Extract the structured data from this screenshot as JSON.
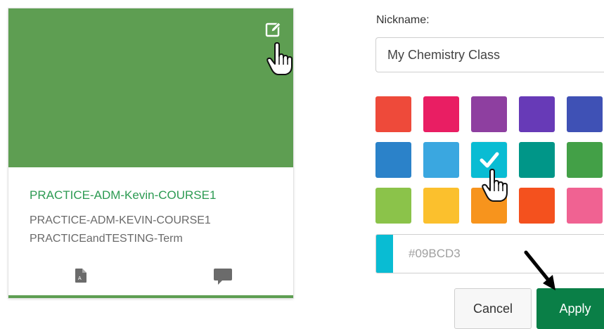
{
  "card": {
    "title": "PRACTICE-ADM-Kevin-COURSE1",
    "code": "PRACTICE-ADM-KEVIN-COURSE1",
    "term": "PRACTICEandTESTING-Term",
    "hero_color": "#5e9e52",
    "icons": [
      "edit-icon",
      "document-icon",
      "chat-icon"
    ]
  },
  "settings": {
    "nickname_label": "Nickname:",
    "nickname_value": "My Chemistry Class",
    "hex_value": "#09BCD3",
    "selected_color": "#09BCD3",
    "cancel_label": "Cancel",
    "apply_label": "Apply",
    "apply_color": "#0a7f47",
    "swatches": [
      [
        "#ee4a3a",
        "#e91e63",
        "#8e3fa0",
        "#673ab7",
        "#3f51b5"
      ],
      [
        "#2b82c9",
        "#3aa7e0",
        "#09bcd3",
        "#009688",
        "#43a047"
      ],
      [
        "#8bc34a",
        "#fbc02d",
        "#f7941d",
        "#f4511e",
        "#f06292"
      ]
    ]
  }
}
